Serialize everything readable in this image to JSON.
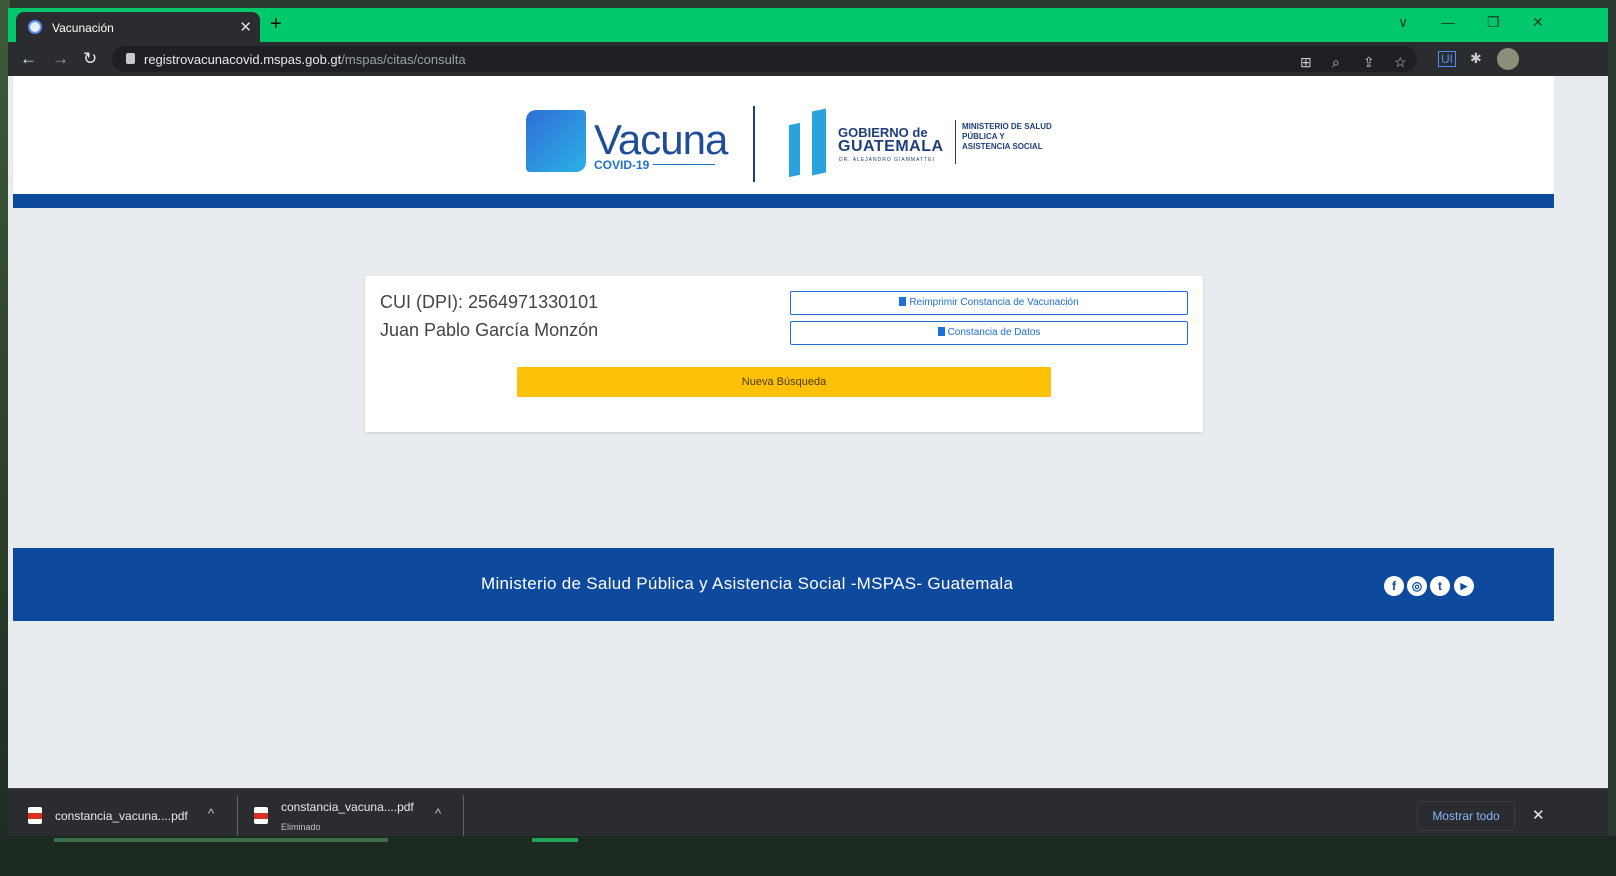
{
  "browser": {
    "tab_title": "Vacunación",
    "tab_close": "✕",
    "new_tab": "+",
    "url_domain": "registrovacunacovid.mspas.gob.gt",
    "url_path": "/mspas/citas/consulta"
  },
  "header": {
    "logo_word": "Vacuna",
    "logo_sub": "COVID-19",
    "gov_top": "GOBIERNO de",
    "gov_main": "GUATEMALA",
    "gov_tiny": "DR. ALEJANDRO GIAMMATTEI",
    "ministry": "MINISTERIO DE SALUD PÚBLICA Y ASISTENCIA SOCIAL"
  },
  "card": {
    "cui": "CUI (DPI): 2564971330101",
    "name": "Juan Pablo García Monzón",
    "reprint_button": "Reimprimir Constancia de Vacunación",
    "data_button": "Constancia de Datos",
    "new_search_button": "Nueva Búsqueda"
  },
  "footer": {
    "text": "Ministerio de Salud Pública y Asistencia Social -MSPAS- Guatemala",
    "social": [
      "f",
      "◎",
      "t",
      "▶"
    ]
  },
  "downloads": {
    "items": [
      {
        "name": "constancia_vacuna....pdf",
        "status": ""
      },
      {
        "name": "constancia_vacuna....pdf",
        "status": "Eliminado"
      }
    ],
    "show_all": "Mostrar todo",
    "close": "✕"
  },
  "icons": {
    "back": "←",
    "forward": "→",
    "reload": "↻",
    "translate": "⊞",
    "zoom": "⌕",
    "share": "⇪",
    "star": "☆",
    "puzzle": "✱",
    "chevron_up": "^",
    "minimize": "—",
    "restore": "❐",
    "close": "✕",
    "tab_search": "∨"
  }
}
